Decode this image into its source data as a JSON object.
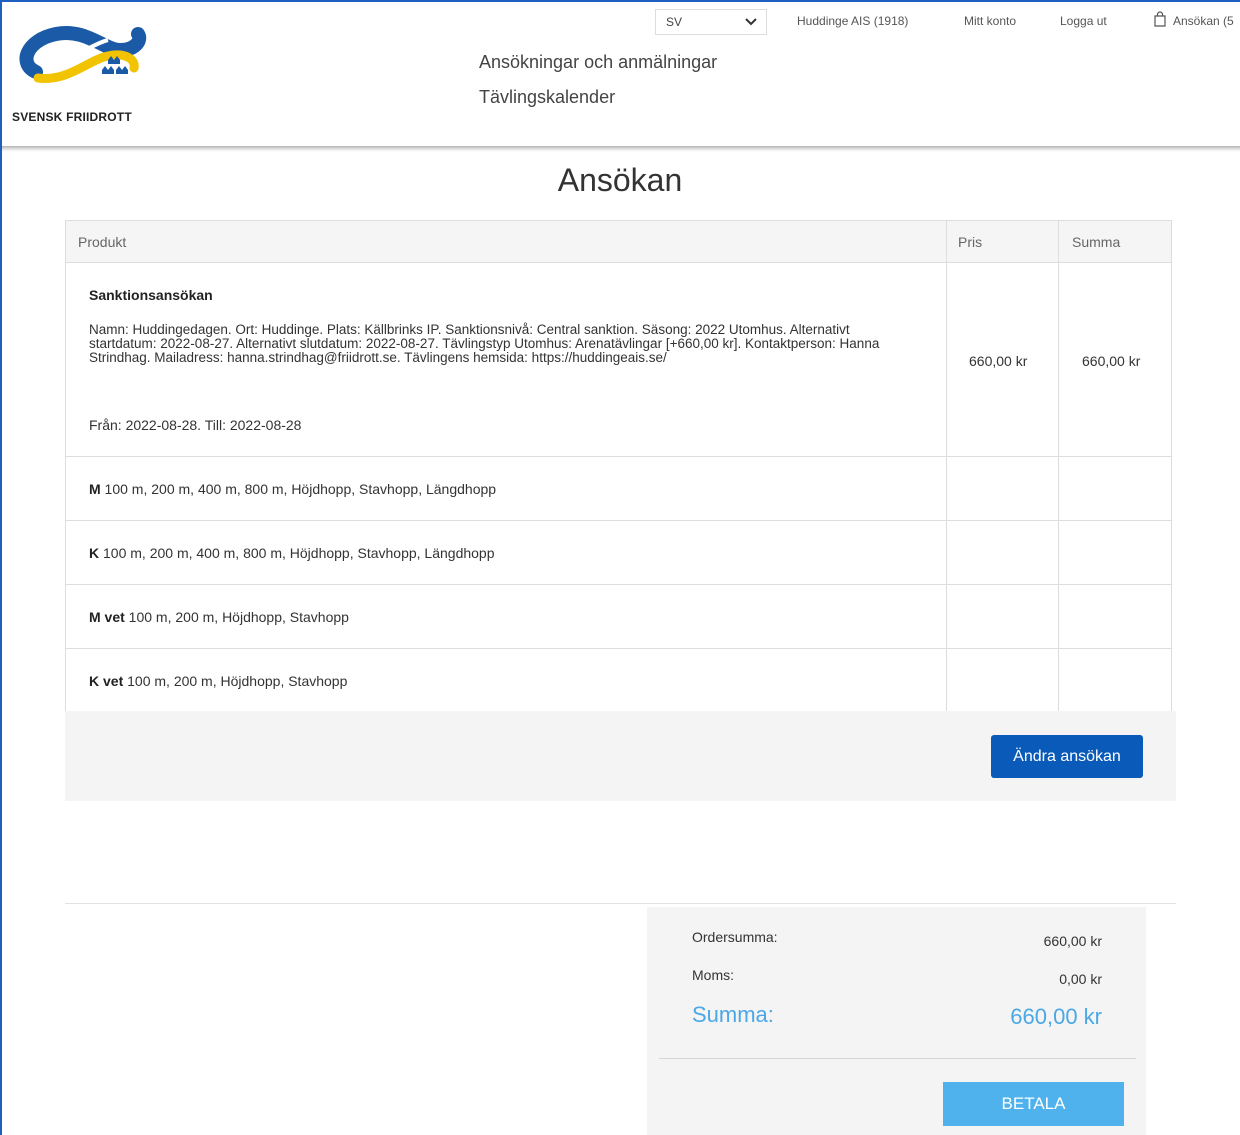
{
  "header": {
    "logo_text": "SVENSK FRIIDROTT",
    "language": "SV",
    "club": "Huddinge AIS (1918)",
    "my_account": "Mitt konto",
    "logout": "Logga ut",
    "cart_link": "Ansökan (5",
    "nav": [
      "Ansökningar och anmälningar",
      "Tävlingskalender"
    ]
  },
  "page": {
    "title": "Ansökan"
  },
  "table": {
    "headers": {
      "product": "Produkt",
      "price": "Pris",
      "sum": "Summa"
    },
    "main_item": {
      "title": "Sanktionsansökan",
      "description": "Namn: Huddingedagen. Ort: Huddinge. Plats: Källbrinks IP. Sanktionsnivå: Central sanktion. Säsong: 2022 Utomhus. Alternativt startdatum: 2022-08-27. Alternativt slutdatum: 2022-08-27. Tävlingstyp Utomhus: Arenatävlingar [+660,00 kr]. Kontaktperson: Hanna Strindhag. Mailadress: hanna.strindhag@friidrott.se. Tävlingens hemsida: https://huddingeais.se/",
      "dates": "Från: 2022-08-28. Till: 2022-08-28",
      "price": "660,00 kr",
      "sum": "660,00 kr"
    },
    "events": [
      {
        "class": "M",
        "list": " 100 m, 200 m, 400 m, 800 m, Höjdhopp, Stavhopp, Längdhopp"
      },
      {
        "class": "K",
        "list": " 100 m, 200 m, 400 m, 800 m, Höjdhopp, Stavhopp, Längdhopp"
      },
      {
        "class": "M vet",
        "list": " 100 m, 200 m, Höjdhopp, Stavhopp"
      },
      {
        "class": "K vet",
        "list": " 100 m, 200 m, Höjdhopp, Stavhopp"
      }
    ]
  },
  "actions": {
    "edit_label": "Ändra ansökan"
  },
  "summary": {
    "order_label": "Ordersumma:",
    "order_value": "660,00 kr",
    "vat_label": "Moms:",
    "vat_value": "0,00 kr",
    "total_label": "Summa:",
    "total_value": "660,00 kr",
    "pay_label": "BETALA"
  },
  "colors": {
    "primary_button": "#0a5ab9",
    "pay_button": "#4fb2ec",
    "total_text": "#4aa8e6",
    "logo_blue": "#1b5aa6",
    "logo_yellow": "#f2c300"
  },
  "icons": [
    "svensk-friidrott-logo",
    "chevron-down-icon",
    "shopping-bag-icon"
  ]
}
